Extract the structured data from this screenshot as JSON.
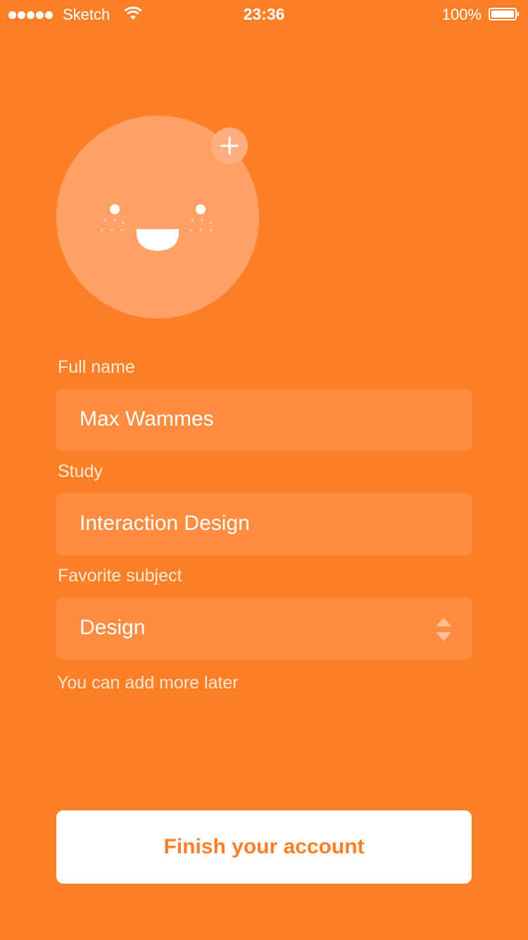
{
  "status_bar": {
    "carrier": "Sketch",
    "time": "23:36",
    "battery_percent": "100%",
    "signal_icon": "signal-dots-icon",
    "wifi_icon": "wifi-icon",
    "battery_icon": "battery-icon"
  },
  "avatar": {
    "face_icon": "smiling-face-icon",
    "add_icon": "plus-icon"
  },
  "form": {
    "full_name": {
      "label": "Full name",
      "value": "Max Wammes"
    },
    "study": {
      "label": "Study",
      "value": "Interaction Design"
    },
    "favorite_subject": {
      "label": "Favorite subject",
      "value": "Design",
      "icon": "select-chevrons-icon"
    },
    "hint": "You can add more later"
  },
  "actions": {
    "finish_label": "Finish your account"
  },
  "colors": {
    "background": "#FF7F27",
    "avatar": "#FFA066",
    "field": "#FF8C3F",
    "button": "#FFFFFF",
    "button_text": "#FF7F27"
  }
}
